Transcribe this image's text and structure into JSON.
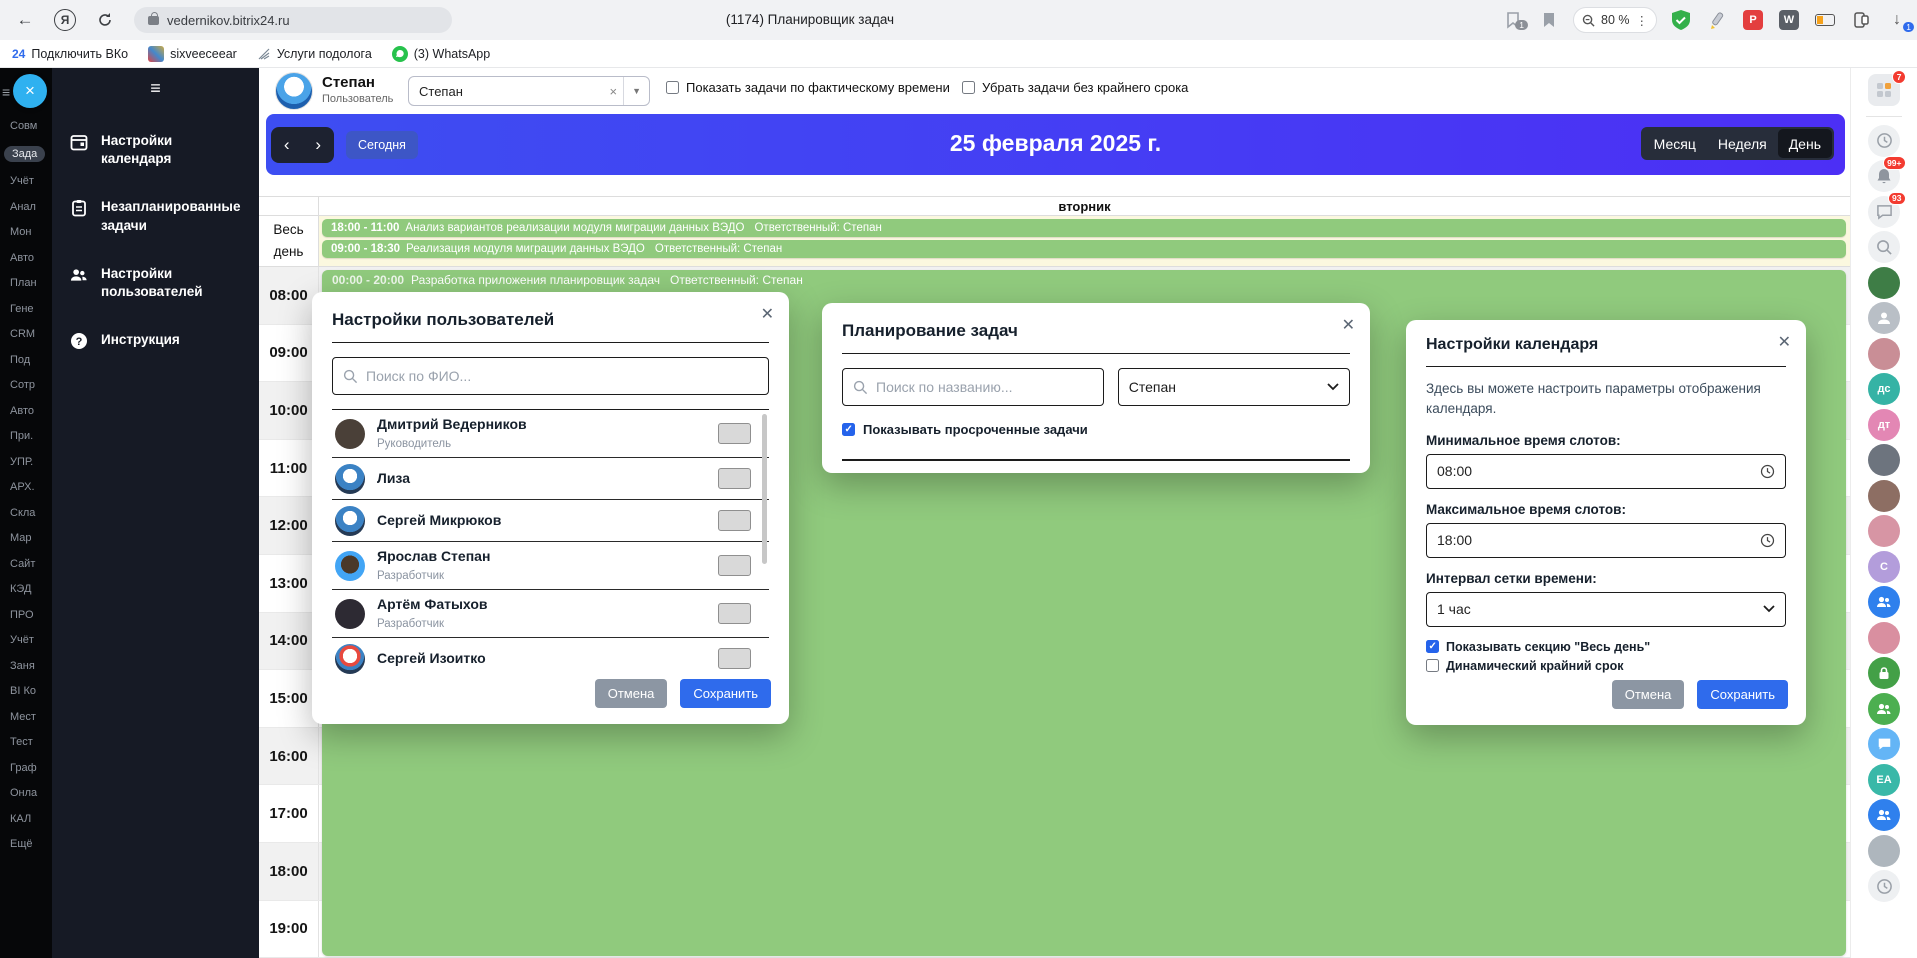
{
  "colors": {
    "accent_blue": "#4436f2",
    "event_green": "#90ca7d",
    "allday_cream": "#fbf8df",
    "save_blue": "#2f6bec",
    "cancel_gray": "#8c96a3",
    "checkbox_blue": "#2563eb",
    "badge_red": "#f33b30",
    "sidebar_dark": "#161a25"
  },
  "browser": {
    "url": "vedernikov.bitrix24.ru",
    "tab_title": "(1174) Планировщик задач",
    "zoom_level": "80 %",
    "collections_badge": "1",
    "download_badge": "1",
    "bookmarks": [
      {
        "label": "Подключить ВКо",
        "icon": "24"
      },
      {
        "label": "sixveeceear",
        "icon": ""
      },
      {
        "label": "Услуги подолога",
        "icon": ""
      },
      {
        "label": "(3) WhatsApp",
        "icon": ""
      }
    ]
  },
  "sidebar_left": {
    "active": "Зада",
    "items": [
      "Совм",
      "Зада",
      "Учёт",
      "Анал",
      "Мон",
      "Авто",
      "План",
      "Гене",
      "CRM",
      "Под",
      "Сотр",
      "Авто",
      "При.",
      "УПР.",
      "АРХ.",
      "Скла",
      "Мар",
      "Сайт",
      "КЭД",
      "ПРО",
      "Учёт",
      "Заня",
      "BI Ко",
      "Мест",
      "Тест",
      "Граф",
      "Онла",
      "КАЛ",
      "Ещё"
    ]
  },
  "app_menu": {
    "items": [
      {
        "label": "Настройки календаря",
        "icon": "calendar-icon"
      },
      {
        "label": "Незапланированные задачи",
        "icon": "clipboard-icon"
      },
      {
        "label": "Настройки пользователей",
        "icon": "users-icon"
      },
      {
        "label": "Инструкция",
        "icon": "help-icon"
      }
    ]
  },
  "header": {
    "user_name": "Степан",
    "user_role": "Пользователь",
    "user_select_value": "Степан",
    "checkbox1_label": "Показать задачи по фактическому времени",
    "checkbox1_checked": false,
    "checkbox2_label": "Убрать задачи без крайнего срока",
    "checkbox2_checked": false
  },
  "calendar_bar": {
    "today_label": "Сегодня",
    "date_title": "25 февраля 2025 г.",
    "views": [
      "Месяц",
      "Неделя",
      "День"
    ],
    "active_view": "День"
  },
  "calendar": {
    "day_header": "вторник",
    "all_day_label": "Весь день",
    "hours": [
      "08:00",
      "09:00",
      "10:00",
      "11:00",
      "12:00",
      "13:00",
      "14:00",
      "15:00",
      "16:00",
      "17:00",
      "18:00",
      "19:00"
    ],
    "all_day_events": [
      {
        "time": "18:00 - 11:00",
        "title": "Анализ вариантов реализации модуля миграции данных ВЭДО",
        "owner": "Ответственный: Степан"
      },
      {
        "time": "09:00 - 18:30",
        "title": "Реализация модуля миграции данных ВЭДО",
        "owner": "Ответственный: Степан"
      }
    ],
    "timed_event": {
      "time": "00:00 - 20:00",
      "title": "Разработка приложения планировщик задач",
      "owner": "Ответственный: Степан"
    }
  },
  "modal_users": {
    "title": "Настройки пользователей",
    "search_placeholder": "Поиск по ФИО...",
    "users": [
      {
        "name": "Дмитрий Ведерников",
        "role": "Руководитель"
      },
      {
        "name": "Лиза",
        "role": ""
      },
      {
        "name": "Сергей Микрюков",
        "role": ""
      },
      {
        "name": "Ярослав Степан",
        "role": "Разработчик"
      },
      {
        "name": "Артём Фатыхов",
        "role": "Разработчик"
      },
      {
        "name": "Сергей Изоитко",
        "role": ""
      }
    ],
    "cancel_label": "Отмена",
    "save_label": "Сохранить"
  },
  "modal_planning": {
    "title": "Планирование задач",
    "search_placeholder": "Поиск по названию...",
    "user_select_value": "Степан",
    "checkbox_label": "Показывать просроченные задачи",
    "checkbox_checked": true
  },
  "modal_calendar_settings": {
    "title": "Настройки календаря",
    "description": "Здесь вы можете настроить параметры отображения календаря.",
    "min_label": "Минимальное время слотов:",
    "min_value": "08:00",
    "max_label": "Максимальное время слотов:",
    "max_value": "18:00",
    "interval_label": "Интервал сетки времени:",
    "interval_value": "1 час",
    "checkbox1_label": "Показывать секцию \"Весь день\"",
    "checkbox1_checked": true,
    "checkbox2_label": "Динамический крайний срок",
    "checkbox2_checked": false,
    "cancel_label": "Отмена",
    "save_label": "Сохранить"
  },
  "right_rail": {
    "items": [
      {
        "icon": "widget-icon",
        "initials": "",
        "badge": "7"
      },
      {
        "icon": "clock-icon",
        "initials": "",
        "badge": ""
      },
      {
        "icon": "bell-icon",
        "initials": "",
        "badge": "99+"
      },
      {
        "icon": "chat-icon",
        "initials": "",
        "badge": "93"
      },
      {
        "icon": "search-icon",
        "initials": "",
        "badge": ""
      },
      {
        "icon": "avatar",
        "initials": "",
        "badge": ""
      },
      {
        "icon": "avatar",
        "initials": "",
        "badge": ""
      },
      {
        "icon": "avatar",
        "initials": "",
        "badge": ""
      },
      {
        "icon": "avatar",
        "initials": "дс",
        "badge": ""
      },
      {
        "icon": "avatar",
        "initials": "дт",
        "badge": ""
      },
      {
        "icon": "avatar",
        "initials": "",
        "badge": ""
      },
      {
        "icon": "avatar",
        "initials": "",
        "badge": ""
      },
      {
        "icon": "avatar",
        "initials": "",
        "badge": ""
      },
      {
        "icon": "avatar",
        "initials": "C",
        "badge": ""
      },
      {
        "icon": "people-icon",
        "initials": "",
        "badge": ""
      },
      {
        "icon": "avatar",
        "initials": "",
        "badge": ""
      },
      {
        "icon": "lock-icon",
        "initials": "",
        "badge": ""
      },
      {
        "icon": "people-icon",
        "initials": "",
        "badge": ""
      },
      {
        "icon": "chat-icon",
        "initials": "",
        "badge": ""
      },
      {
        "icon": "avatar",
        "initials": "EA",
        "badge": ""
      },
      {
        "icon": "people-icon",
        "initials": "",
        "badge": ""
      },
      {
        "icon": "avatar",
        "initials": "",
        "badge": ""
      },
      {
        "icon": "clock-icon",
        "initials": "",
        "badge": ""
      }
    ]
  }
}
